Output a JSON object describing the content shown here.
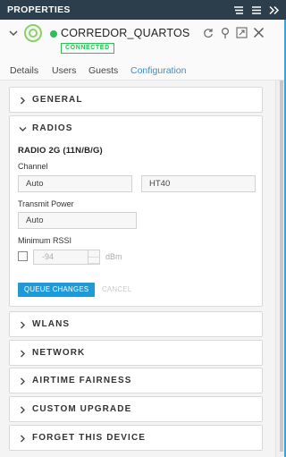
{
  "titlebar": {
    "title": "PROPERTIES",
    "icons": [
      "list-view-icon",
      "menu-icon",
      "collapse-right-icon"
    ]
  },
  "device": {
    "name": "CORREDOR_QUARTOS",
    "status": "CONNECTED",
    "status_color": "#2ebd5a",
    "actions": [
      "restart-icon",
      "locate-icon",
      "expand-icon",
      "close-icon"
    ]
  },
  "tabs": [
    {
      "label": "Details"
    },
    {
      "label": "Users"
    },
    {
      "label": "Guests"
    },
    {
      "label": "Configuration",
      "active": true
    }
  ],
  "sections": {
    "general": "GENERAL",
    "radios": "RADIOS",
    "wlans": "WLANS",
    "network": "NETWORK",
    "airtime": "AIRTIME FAIRNESS",
    "upgrade": "CUSTOM UPGRADE",
    "forget": "FORGET THIS DEVICE"
  },
  "radios": {
    "subheading": "RADIO 2G (11N/B/G)",
    "channel_label": "Channel",
    "channel_value": "Auto",
    "width_value": "HT40",
    "power_label": "Transmit Power",
    "power_value": "Auto",
    "rssi_label": "Minimum RSSI",
    "rssi_value": "-94",
    "rssi_unit": "dBm",
    "queue_button": "QUEUE CHANGES",
    "cancel_button": "CANCEL"
  },
  "colors": {
    "accent": "#1e9bd7",
    "titlebar": "#2c3e4c"
  }
}
